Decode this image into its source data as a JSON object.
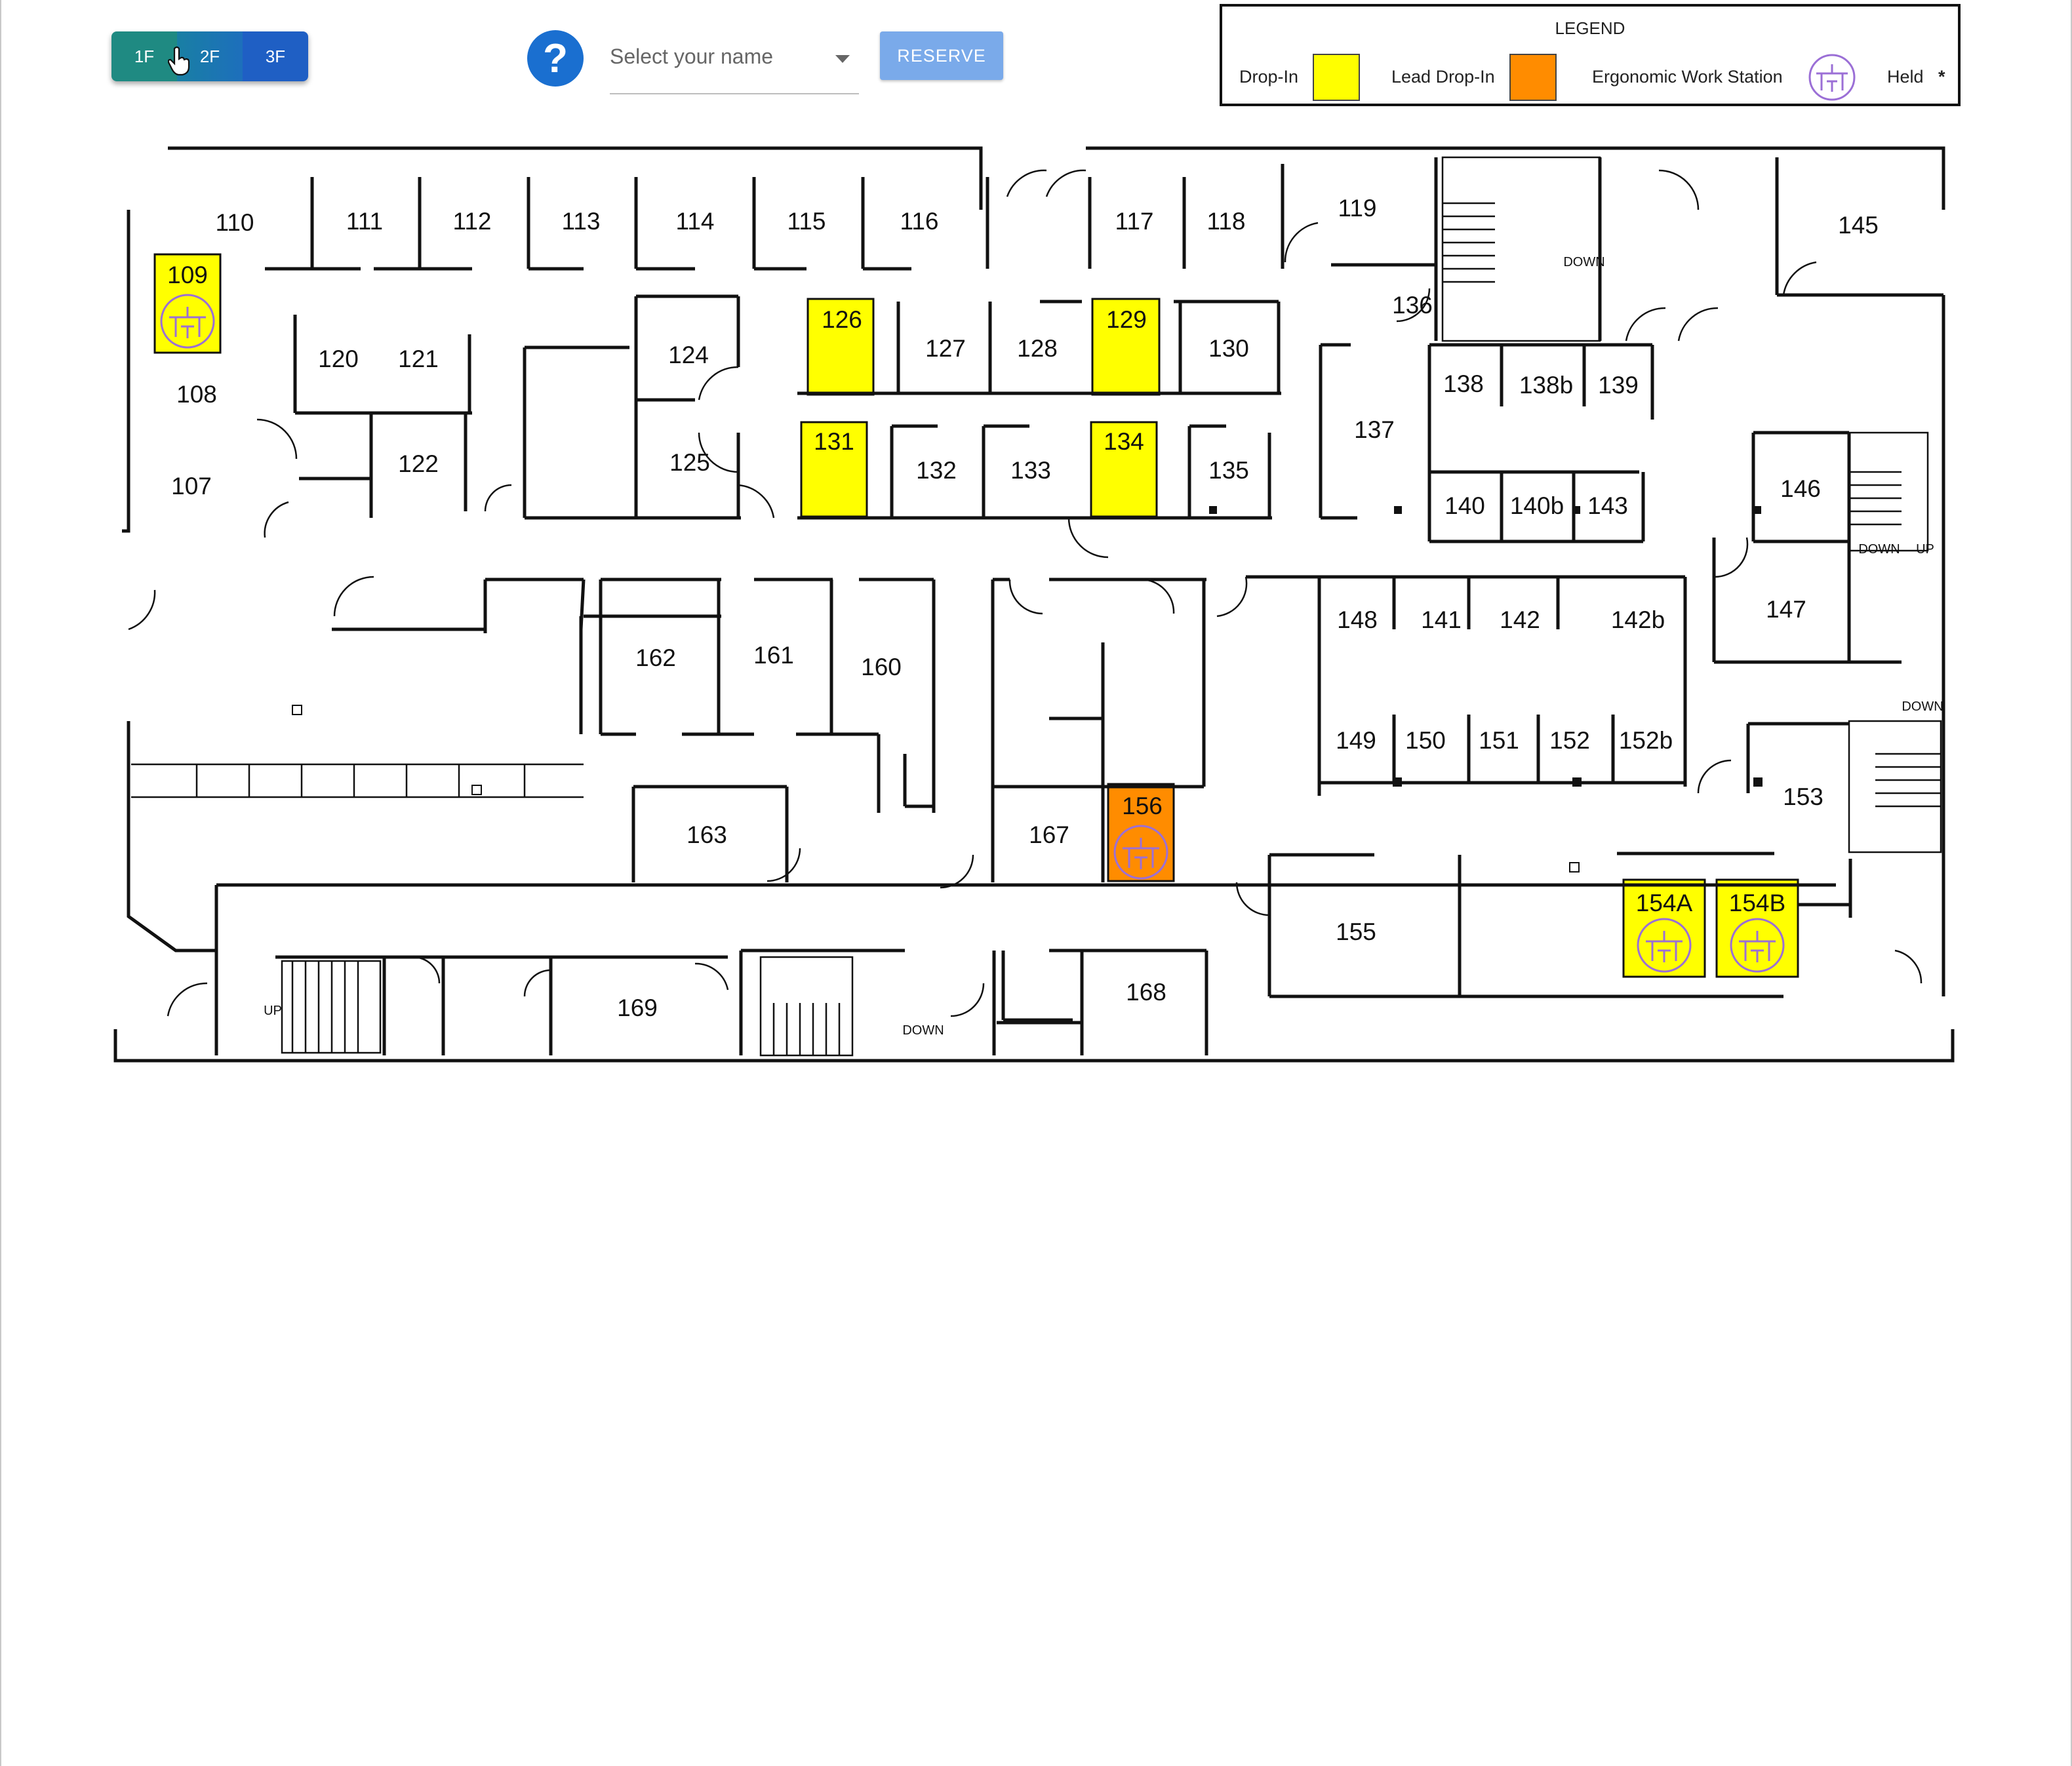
{
  "floors": {
    "items": [
      {
        "label": "1F",
        "active": true
      },
      {
        "label": "2F",
        "active": false
      },
      {
        "label": "3F",
        "active": false
      }
    ]
  },
  "help": {
    "label": "?"
  },
  "name_select": {
    "placeholder": "Select your name",
    "value": ""
  },
  "reserve": {
    "label": "RESERVE"
  },
  "legend": {
    "title": "LEGEND",
    "drop_in": {
      "label": "Drop-In",
      "color": "#ffff00"
    },
    "lead_drop_in": {
      "label": "Lead Drop-In",
      "color": "#ff8c00"
    },
    "ergonomic": {
      "label": "Ergonomic Work Station",
      "icon": "ergonomic-workstation-icon",
      "color": "#9b6fd6"
    },
    "held": {
      "label": "Held",
      "symbol": "*"
    }
  },
  "floorplan": {
    "rooms": [
      "110",
      "111",
      "112",
      "113",
      "114",
      "115",
      "116",
      "117",
      "118",
      "119",
      "145",
      "109",
      "120",
      "121",
      "124",
      "126",
      "127",
      "128",
      "129",
      "130",
      "136",
      "138",
      "138b",
      "139",
      "108",
      "122",
      "125",
      "131",
      "132",
      "133",
      "134",
      "135",
      "137",
      "140",
      "140b",
      "143",
      "146",
      "107",
      "148",
      "141",
      "142",
      "142b",
      "147",
      "162",
      "161",
      "160",
      "149",
      "150",
      "151",
      "152",
      "152b",
      "153",
      "163",
      "167",
      "156",
      "155",
      "154A",
      "154B",
      "169",
      "168"
    ],
    "reservable": {
      "drop_in": [
        "109",
        "126",
        "129",
        "131",
        "134",
        "154A",
        "154B"
      ],
      "lead_drop_in": [
        "156"
      ],
      "ergonomic": [
        "109",
        "156",
        "154A",
        "154B"
      ]
    },
    "stair_labels": [
      "DOWN",
      "DOWN",
      "UP",
      "DOWN",
      "UP",
      "DOWN"
    ]
  }
}
